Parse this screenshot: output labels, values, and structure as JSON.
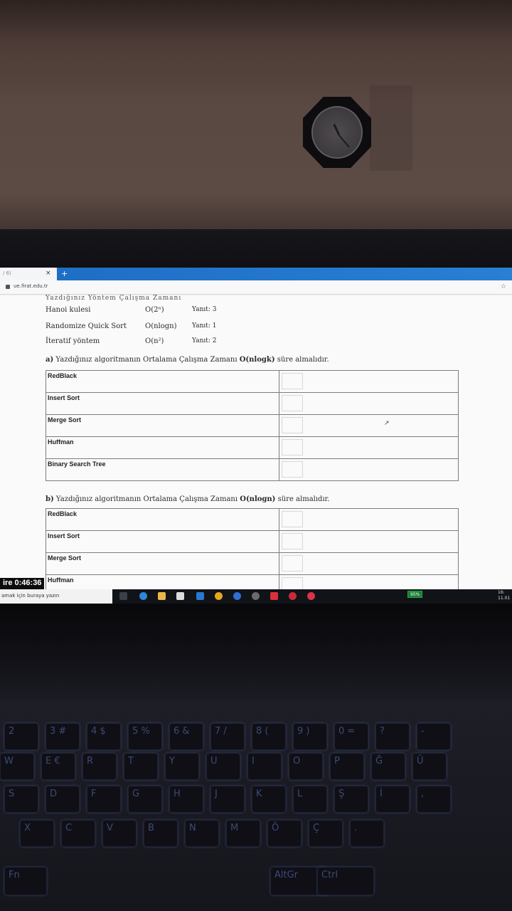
{
  "browser": {
    "tab_label": "/ 6)",
    "tab_close": "×",
    "new_tab": "+",
    "url": "ue.firat.edu.tr",
    "star": "☆"
  },
  "document": {
    "cutoff_heading": "Yazdığınız Yöntem          Çalışma Zamanı",
    "algorithms": [
      {
        "name": "Hanoi kulesi",
        "complexity": "O(2ⁿ)",
        "answer": "Yanıt: 3"
      },
      {
        "name": "Randomize Quick Sort",
        "complexity": "O(nlogn)",
        "answer": "Yanıt: 1"
      },
      {
        "name": "İteratif yöntem",
        "complexity": "O(n²)",
        "answer": "Yanıt: 2"
      }
    ],
    "question_a": {
      "prefix": "a)",
      "text": "Yazdığınız algoritmanın Ortalama Çalışma Zamanı",
      "complexity": "O(nlogk)",
      "suffix": "süre almalıdır.",
      "rows": [
        "RedBlack",
        "Insert Sort",
        "Merge Sort",
        "Huffman",
        "Binary Search Tree"
      ]
    },
    "question_b": {
      "prefix": "b)",
      "text": "Yazdığınız algoritmanın Ortalama Çalışma Zamanı",
      "complexity": "O(nlogn)",
      "suffix": "süre almalıdır.",
      "rows": [
        "RedBlack",
        "Insert Sort",
        "Merge Sort",
        "Huffman"
      ]
    }
  },
  "timer": "ire 0:46:36",
  "taskbar": {
    "search_placeholder": "amak için buraya yazın",
    "battery": "95%",
    "time": "16:",
    "date": "11.01"
  },
  "keyboard": {
    "rows": [
      [
        "2",
        "3 #",
        "4 $",
        "5 %",
        "6 &",
        "7 /",
        "8 (",
        "9 )",
        "0 =",
        "?",
        "-"
      ],
      [
        "W",
        "E €",
        "R",
        "T",
        "Y",
        "U",
        "I",
        "O",
        "P",
        "Ğ",
        "Ü"
      ],
      [
        "S",
        "D",
        "F",
        "G",
        "H",
        "J",
        "K",
        "L",
        "Ş",
        "İ",
        ","
      ],
      [
        "X",
        "C",
        "V",
        "B",
        "N",
        "M",
        "Ö",
        "Ç",
        "."
      ],
      [
        "Fn",
        "AltGr",
        "Ctrl"
      ]
    ]
  },
  "colors": {
    "browser_accent": "#1d6fc4",
    "wall": "#5a4843",
    "keyboard_backlight": "#5a8cff"
  }
}
